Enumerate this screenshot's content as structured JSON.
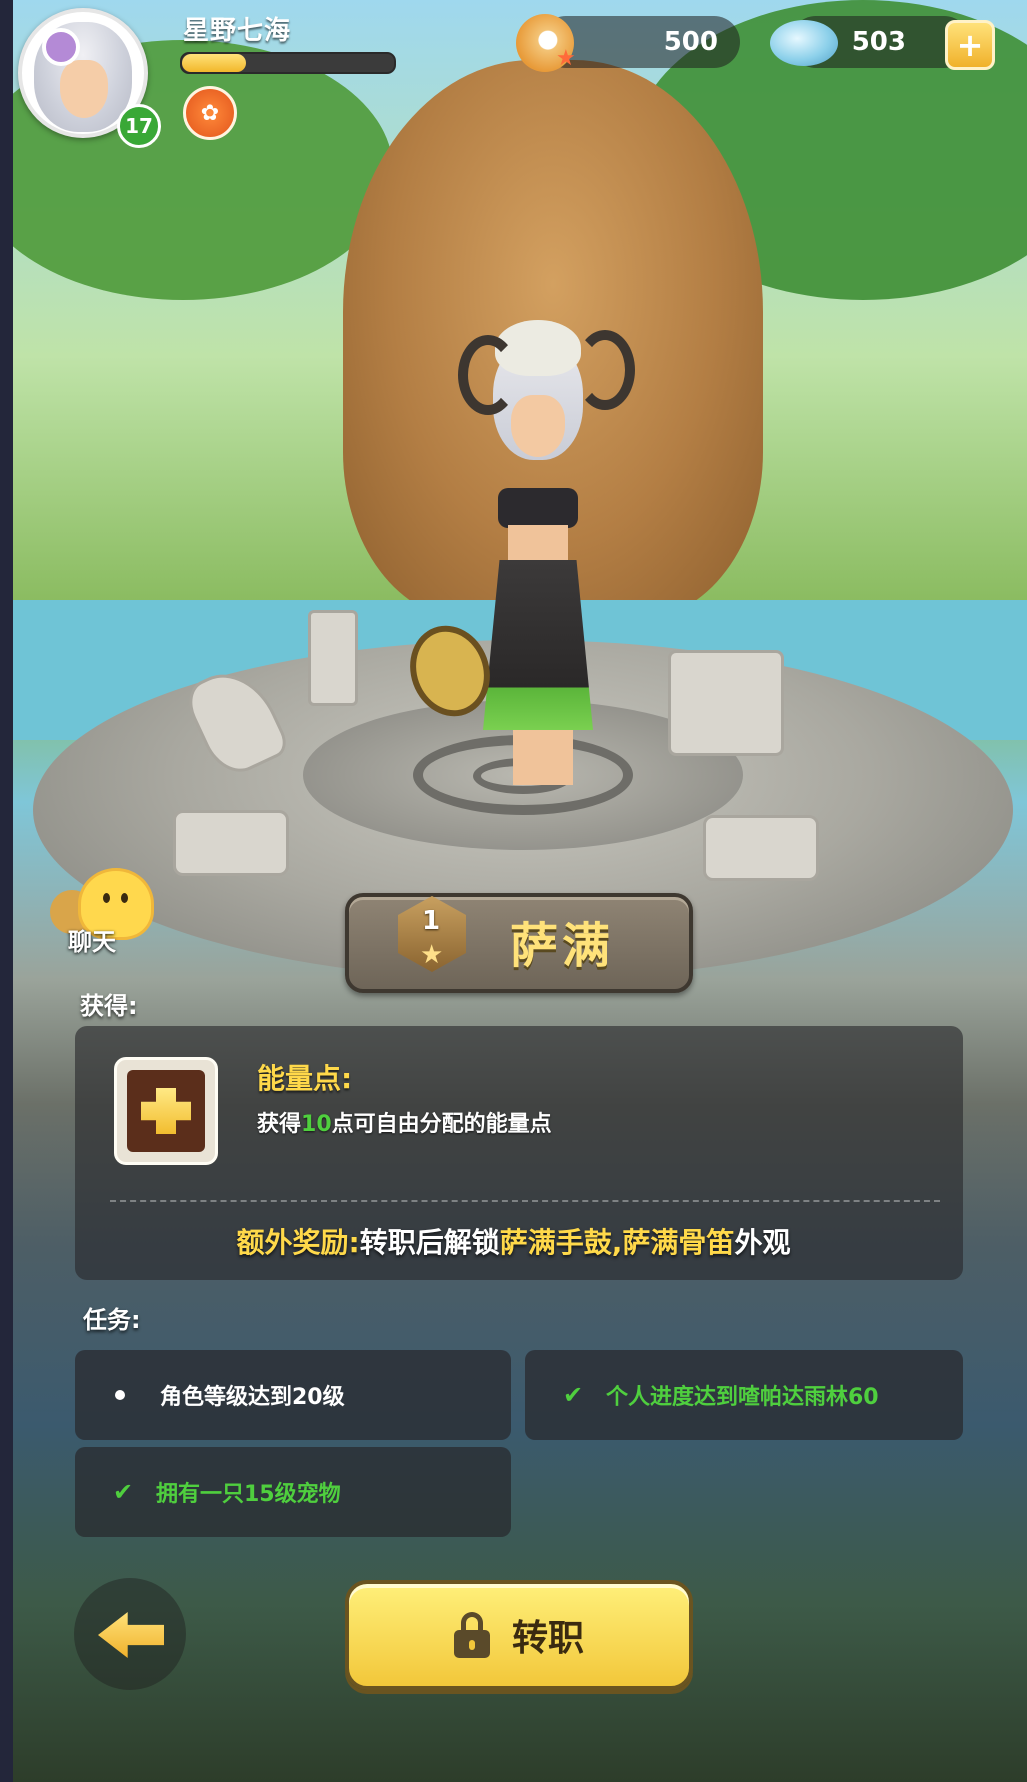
{
  "player": {
    "name": "星野七海",
    "level": "17",
    "xp_fraction": 0.3
  },
  "currencies": {
    "pearls": "500",
    "gems": "503"
  },
  "chat": {
    "label": "聊天"
  },
  "class_info": {
    "rank": "1",
    "name": "萨满"
  },
  "reward": {
    "section_label": "获得:",
    "title": "能量点:",
    "desc_prefix": "获得",
    "desc_amount": "10",
    "desc_suffix": "点可自由分配的能量点",
    "bonus_prefix": "额外奖励:",
    "bonus_middle": "转职后解锁",
    "bonus_item_1": "萨满手鼓",
    "bonus_separator": ",",
    "bonus_item_2": "萨满骨笛",
    "bonus_suffix": "外观"
  },
  "tasks": {
    "section_label": "任务:",
    "items": [
      {
        "text": "角色等级达到20级",
        "done": false
      },
      {
        "text": "个人进度达到喳帕达雨林60",
        "done": true
      },
      {
        "text": "拥有一只15级宠物",
        "done": true
      }
    ]
  },
  "actions": {
    "job_change_label": "转职"
  },
  "icons": {
    "check": "✔",
    "star": "★",
    "plus": "+"
  },
  "colors": {
    "accent_yellow": "#ffd94a",
    "done_green": "#4fcf3e"
  }
}
